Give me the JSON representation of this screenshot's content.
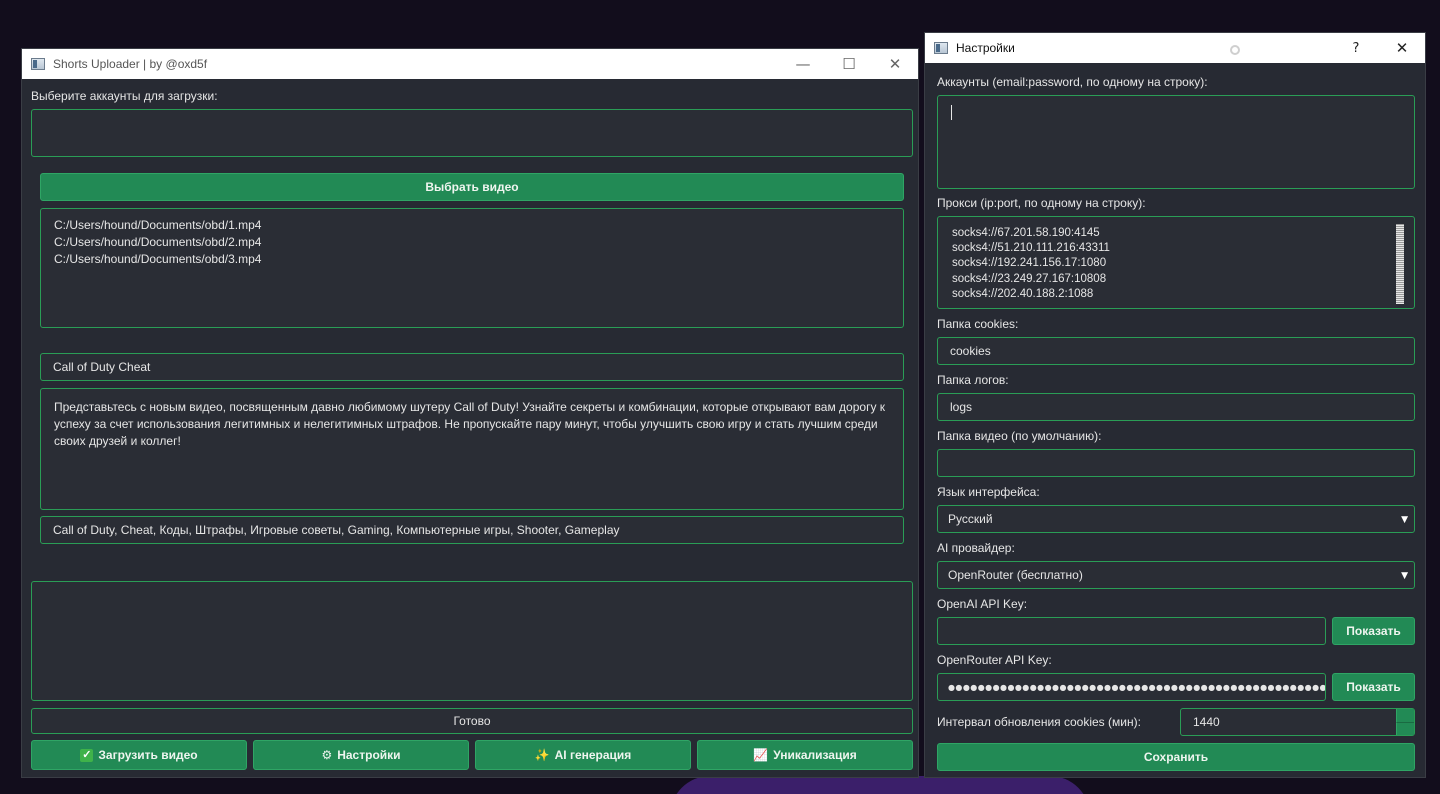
{
  "main_window": {
    "title": "Shorts Uploader | by @oxd5f",
    "accounts_label": "Выберите аккаунты для загрузки:",
    "select_video_button": "Выбрать видео",
    "video_files": "C:/Users/hound/Documents/obd/1.mp4\nC:/Users/hound/Documents/obd/2.mp4\nC:/Users/hound/Documents/obd/3.mp4",
    "video_title": "Call of Duty Cheat",
    "video_description": "Представьтесь с новым видео, посвященным давно любимому шутеру Call of Duty! Узнайте секреты и комбинации, которые открывают вам дорогу к успеху за счет использования легитимных и нелегитимных штрафов. Не пропускайте пару минут, чтобы улучшить свою игру и стать лучшим среди своих друзей и коллег!",
    "video_tags": "Call of Duty, Cheat, Коды, Штрафы, Игровые советы, Gaming, Компьютерные игры, Shooter, Gameplay",
    "log_text": "",
    "status_text": "Готово",
    "buttons": {
      "upload": "Загрузить видео",
      "settings": "Настройки",
      "ai": "AI генерация",
      "unique": "Уникализация"
    },
    "icons": {
      "upload": "check-mark-button-icon",
      "settings": "gear-icon",
      "ai": "sparkles-icon",
      "unique": "chart-increasing-icon"
    }
  },
  "settings_window": {
    "title": "Настройки",
    "accounts_label": "Аккаунты (email:password, по одному на строку):",
    "accounts_value": "",
    "proxy_label": "Прокси (ip:port, по одному на строку):",
    "proxies": "socks4://67.201.58.190:4145\nsocks4://51.210.111.216:43311\nsocks4://192.241.156.17:1080\nsocks4://23.249.27.167:10808\nsocks4://202.40.188.2:1088",
    "cookies_folder_label": "Папка cookies:",
    "cookies_folder_value": "cookies",
    "logs_folder_label": "Папка логов:",
    "logs_folder_value": "logs",
    "video_folder_label": "Папка видео (по умолчанию):",
    "video_folder_value": "",
    "language_label": "Язык интерфейса:",
    "language_value": "Русский",
    "ai_provider_label": "AI провайдер:",
    "ai_provider_value": "OpenRouter (бесплатно)",
    "openai_key_label": "OpenAI API Key:",
    "openai_key_value": "",
    "openrouter_key_label": "OpenRouter API Key:",
    "openrouter_key_value": "●●●●●●●●●●●●●●●●●●●●●●●●●●●●●●●●●●●●●●●●●●●●●●●●●●●●●●●●●●●",
    "show_button": "Показать",
    "interval_label": "Интервал обновления cookies (мин):",
    "interval_value": "1440",
    "save_button": "Сохранить"
  },
  "colors": {
    "accent": "#228a55",
    "border": "#2a9d56",
    "panel": "#272a33"
  }
}
